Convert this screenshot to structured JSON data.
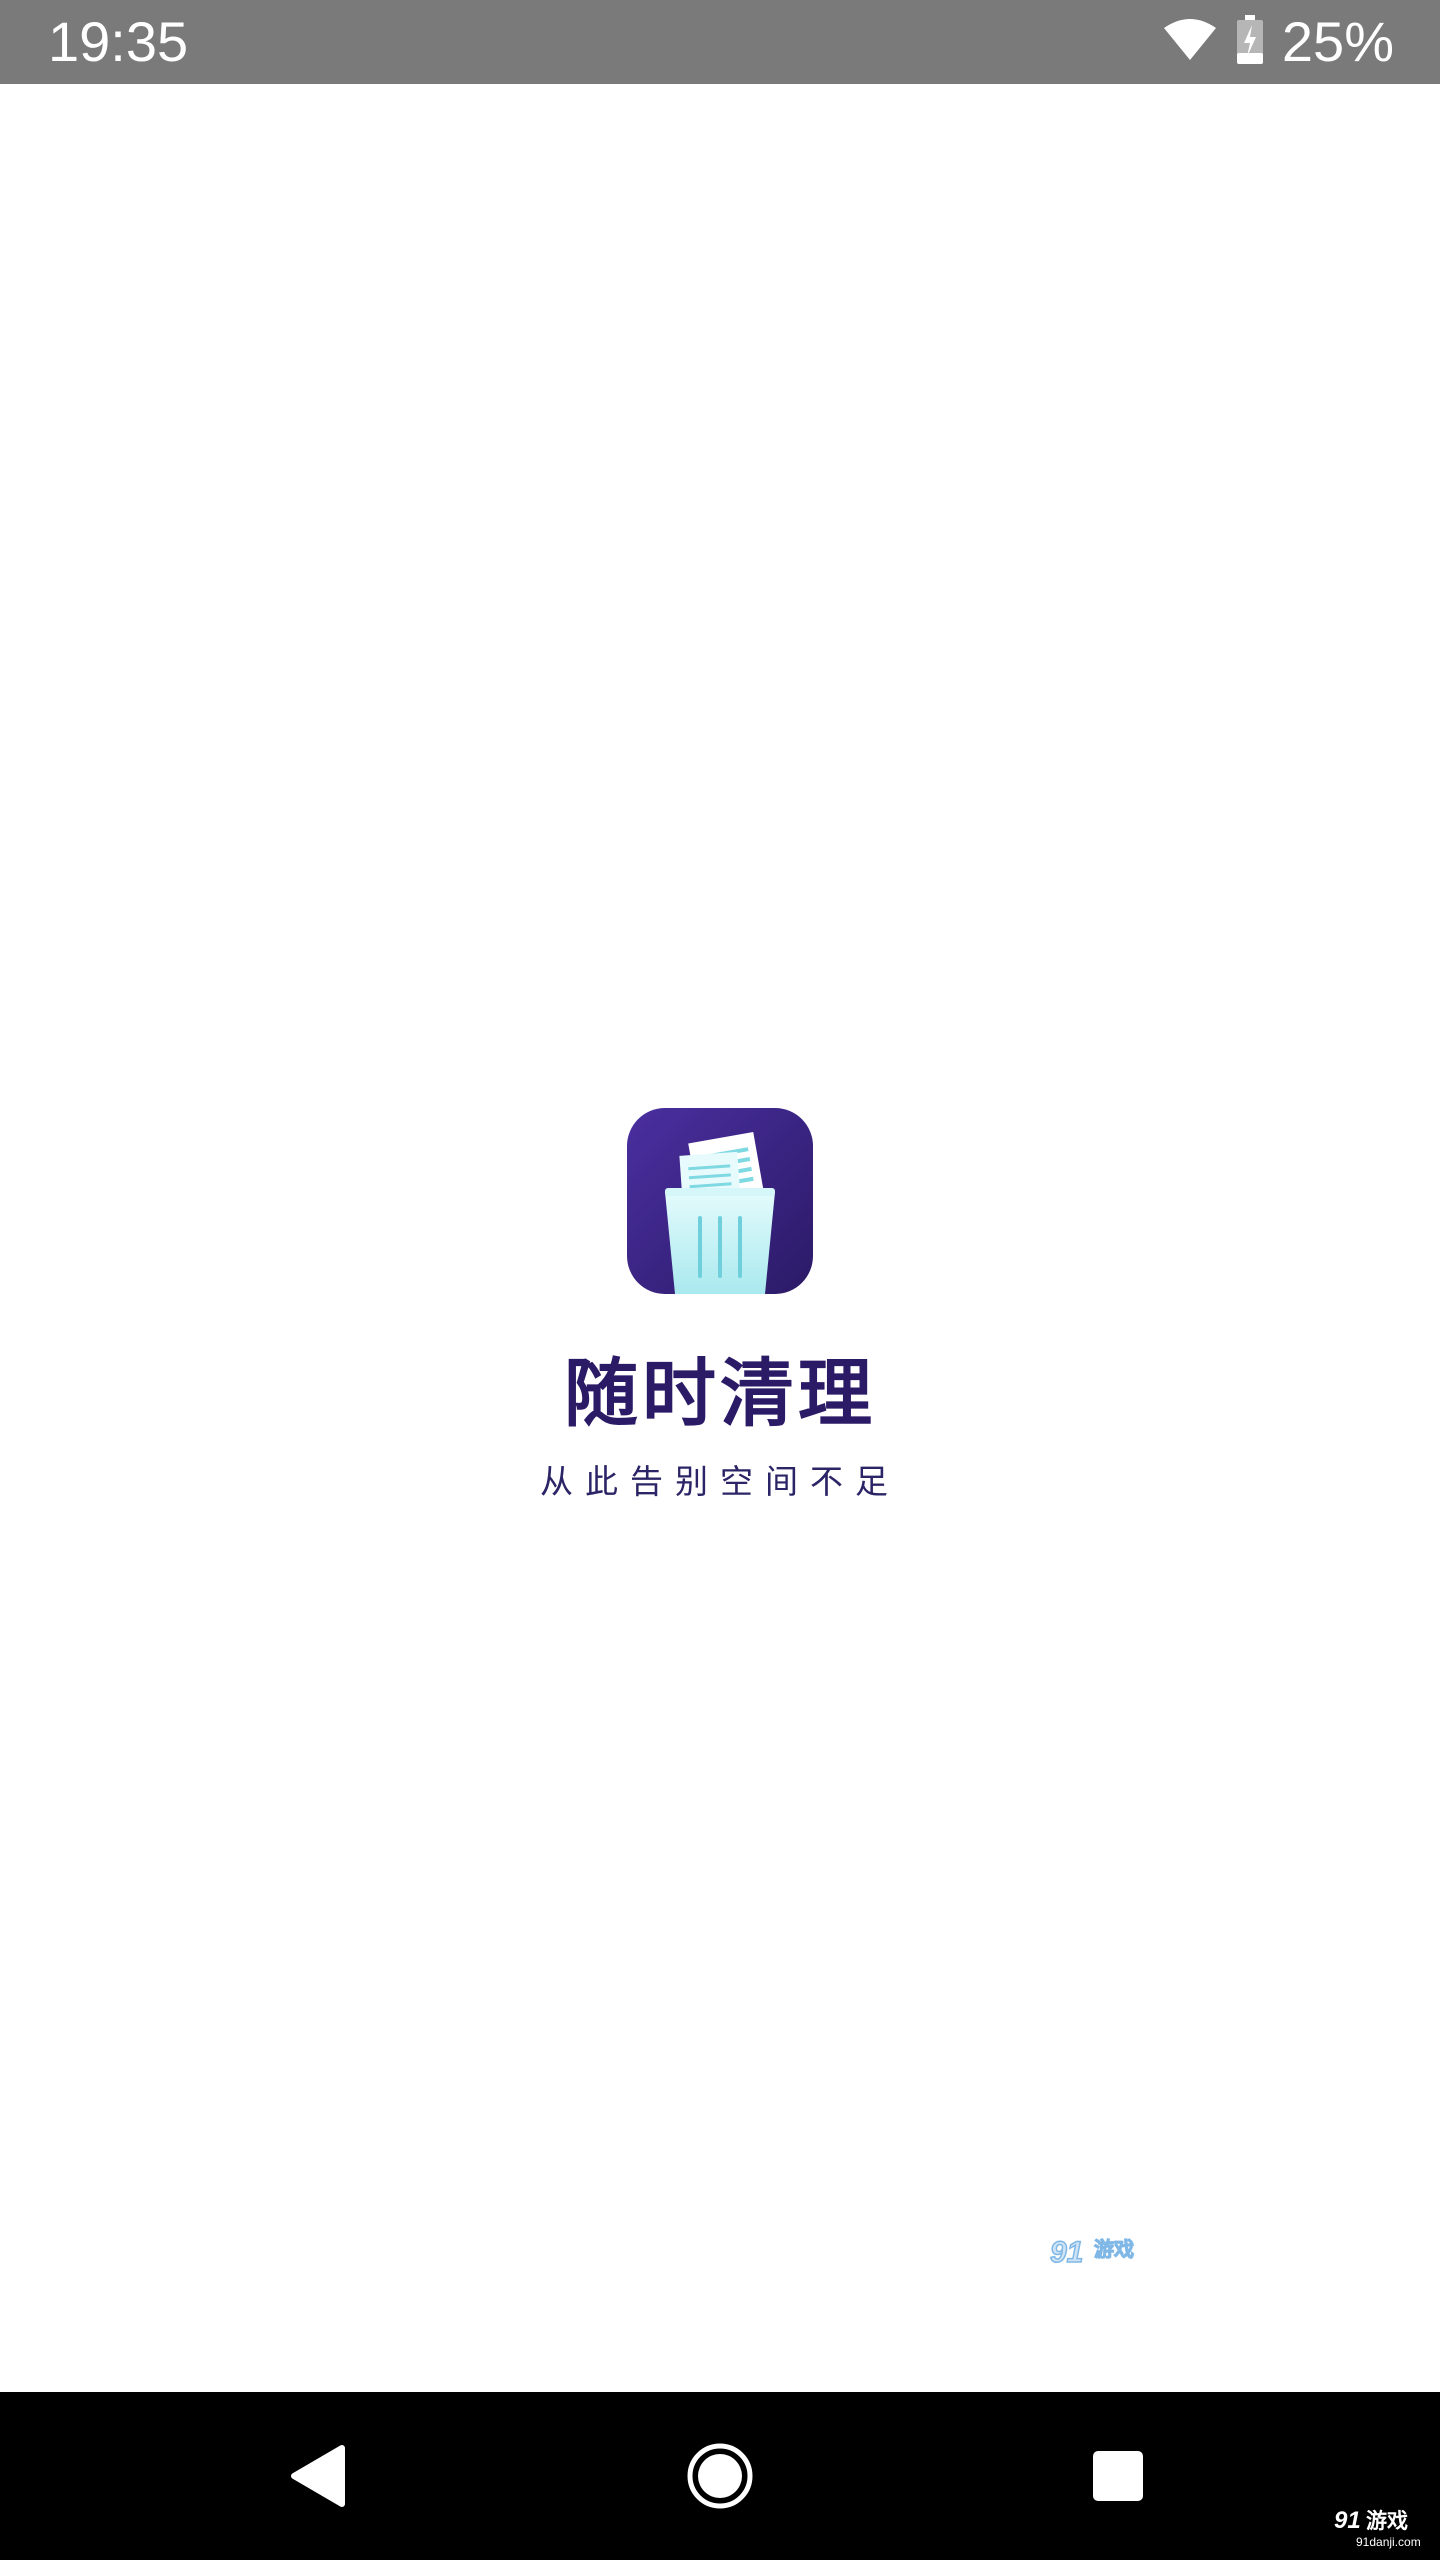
{
  "status_bar": {
    "time": "19:35",
    "battery_percent": "25%",
    "battery_level": 0.25,
    "wifi_icon": "wifi-icon",
    "battery_icon": "battery-charging-icon"
  },
  "splash": {
    "app_icon": "trash-bin-with-papers-icon",
    "app_name": "随时清理",
    "slogan": "从此告别空间不足",
    "colors": {
      "brand_purple_dark": "#2b1a66",
      "brand_purple_light": "#4a2fa0",
      "bin_cyan": "#bff1f5"
    }
  },
  "watermark": {
    "mid_logo_text": "91游戏",
    "corner_logo_text": "91游戏",
    "corner_url": "91danji.com"
  },
  "nav_bar": {
    "back_icon": "back-triangle-icon",
    "home_icon": "home-circle-icon",
    "recents_icon": "recents-square-icon"
  }
}
